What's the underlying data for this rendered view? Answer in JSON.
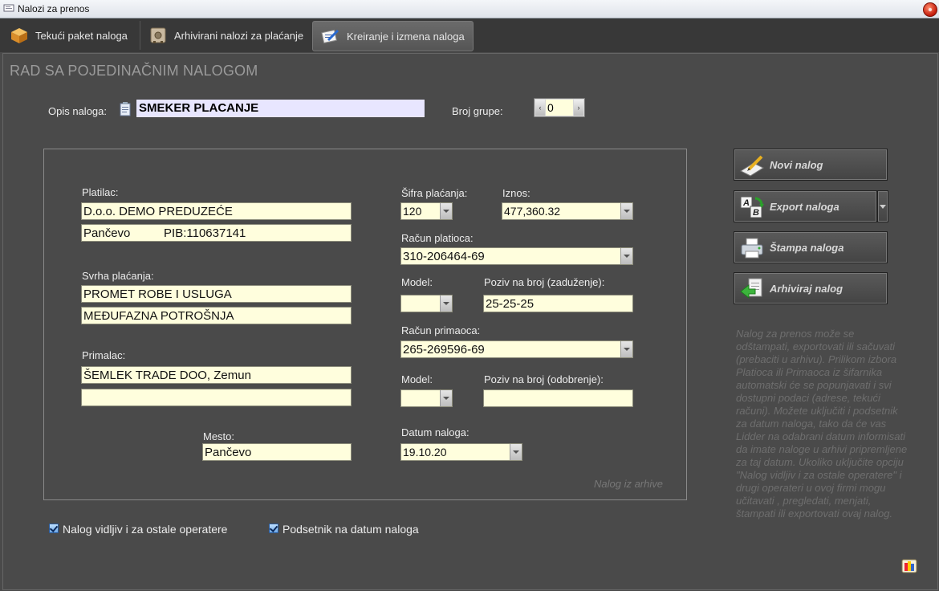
{
  "window": {
    "title": "Nalozi za prenos"
  },
  "tabs": [
    {
      "label": "Tekući paket naloga"
    },
    {
      "label": "Arhivirani nalozi za plaćanje"
    },
    {
      "label": "Kreiranje i izmena naloga"
    }
  ],
  "heading": "RAD SA POJEDINAČNIM NALOGOM",
  "description": {
    "label": "Opis naloga:",
    "value": "SMEKER PLACANJE"
  },
  "group": {
    "label": "Broj grupe:",
    "value": "0"
  },
  "payer": {
    "label": "Platilac:",
    "line1": "D.o.o. DEMO PREDUZEĆE",
    "line2": "Pančevo          PIB:110637141"
  },
  "purpose": {
    "label": "Svrha plaćanja:",
    "line1": "PROMET ROBE I USLUGA",
    "line2": "MEĐUFAZNA POTROŠNJA"
  },
  "recipient": {
    "label": "Primalac:",
    "line1": "ŠEMLEK TRADE DOO, Zemun",
    "line2": ""
  },
  "place": {
    "label": "Mesto:",
    "value": "Pančevo"
  },
  "payment_code": {
    "label": "Šifra plaćanja:",
    "value": "120"
  },
  "amount": {
    "label": "Iznos:",
    "value": "477,360.32"
  },
  "payer_account": {
    "label": "Račun platioca:",
    "value": "310-206464-69"
  },
  "model1": {
    "label": "Model:",
    "value": ""
  },
  "reference_debit": {
    "label": "Poziv na broj (zaduženje):",
    "value": "25-25-25"
  },
  "recipient_account": {
    "label": "Račun primaoca:",
    "value": "265-269596-69"
  },
  "model2": {
    "label": "Model:",
    "value": ""
  },
  "reference_credit": {
    "label": "Poziv na broj (odobrenje):",
    "value": ""
  },
  "order_date": {
    "label": "Datum naloga:",
    "value": "19.10.20"
  },
  "archive_note": "Nalog iz arhive",
  "buttons": {
    "new": "Novi nalog",
    "export": "Export naloga",
    "print": "Štampa naloga",
    "archive": "Arhiviraj nalog"
  },
  "checkboxes": {
    "visible": {
      "label": "Nalog vidljiv i za ostale operatere",
      "checked": true
    },
    "reminder": {
      "label": "Podsetnik na datum naloga",
      "checked": true
    }
  },
  "help_text": "Nalog za prenos može se odštampati, exportovati ili sačuvati (prebaciti u arhivu). Prilikom izbora Platioca ili Primaoca iz šifarnika automatski će se popunjavati i svi dostupni podaci (adrese, tekući računi). Možete uključiti i podsetnik za datum naloga, tako da će vas Lidder na odabrani datum informisati da imate naloge u arhivi pripremljene za taj datum. Ukoliko uključite opciju \"Nalog vidljiv i za ostale operatere\" i drugi operateri u ovoj firmi mogu učitavati , pregledati, menjati, štampati ili exportovati ovaj nalog."
}
